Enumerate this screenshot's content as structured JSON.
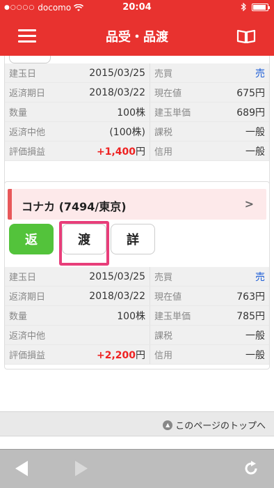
{
  "status": {
    "carrier": "docomo",
    "signal_dots": "●○○○○",
    "time": "20:04"
  },
  "nav": {
    "title": "品受・品渡"
  },
  "card1": {
    "rows": [
      {
        "l_label": "建玉日",
        "l_value": "2015/03/25",
        "r_label": "売買",
        "r_value": "売"
      },
      {
        "l_label": "返済期日",
        "l_value": "2018/03/22",
        "r_label": "現在値",
        "r_value": "675円"
      },
      {
        "l_label": "数量",
        "l_value": "100株",
        "r_label": "建玉単価",
        "r_value": "689円"
      },
      {
        "l_label": "返済中他",
        "l_value": "(100株)",
        "r_label": "課税",
        "r_value": "一般"
      },
      {
        "l_label": "評価損益",
        "l_value": "+1,400",
        "l_unit": "円",
        "r_label": "信用",
        "r_value": "一般"
      }
    ]
  },
  "card2": {
    "stock_name": "コナカ (7494/東京)",
    "buttons": {
      "return": "返",
      "deliver": "渡",
      "detail": "詳"
    },
    "rows": [
      {
        "l_label": "建玉日",
        "l_value": "2015/03/25",
        "r_label": "売買",
        "r_value": "売"
      },
      {
        "l_label": "返済期日",
        "l_value": "2018/03/22",
        "r_label": "現在値",
        "r_value": "763円"
      },
      {
        "l_label": "数量",
        "l_value": "100株",
        "r_label": "建玉単価",
        "r_value": "785円"
      },
      {
        "l_label": "返済中他",
        "l_value": "",
        "r_label": "課税",
        "r_value": "一般"
      },
      {
        "l_label": "評価損益",
        "l_value": "+2,200",
        "l_unit": "円",
        "r_label": "信用",
        "r_value": "一般"
      }
    ]
  },
  "footer": {
    "to_top": "このページのトップへ"
  },
  "colors": {
    "brand_red": "#e8322f",
    "return_green": "#53c33b",
    "highlight_pink": "#e83e7a",
    "profit_red": "#e22222",
    "sell_blue": "#1a5bd6"
  }
}
